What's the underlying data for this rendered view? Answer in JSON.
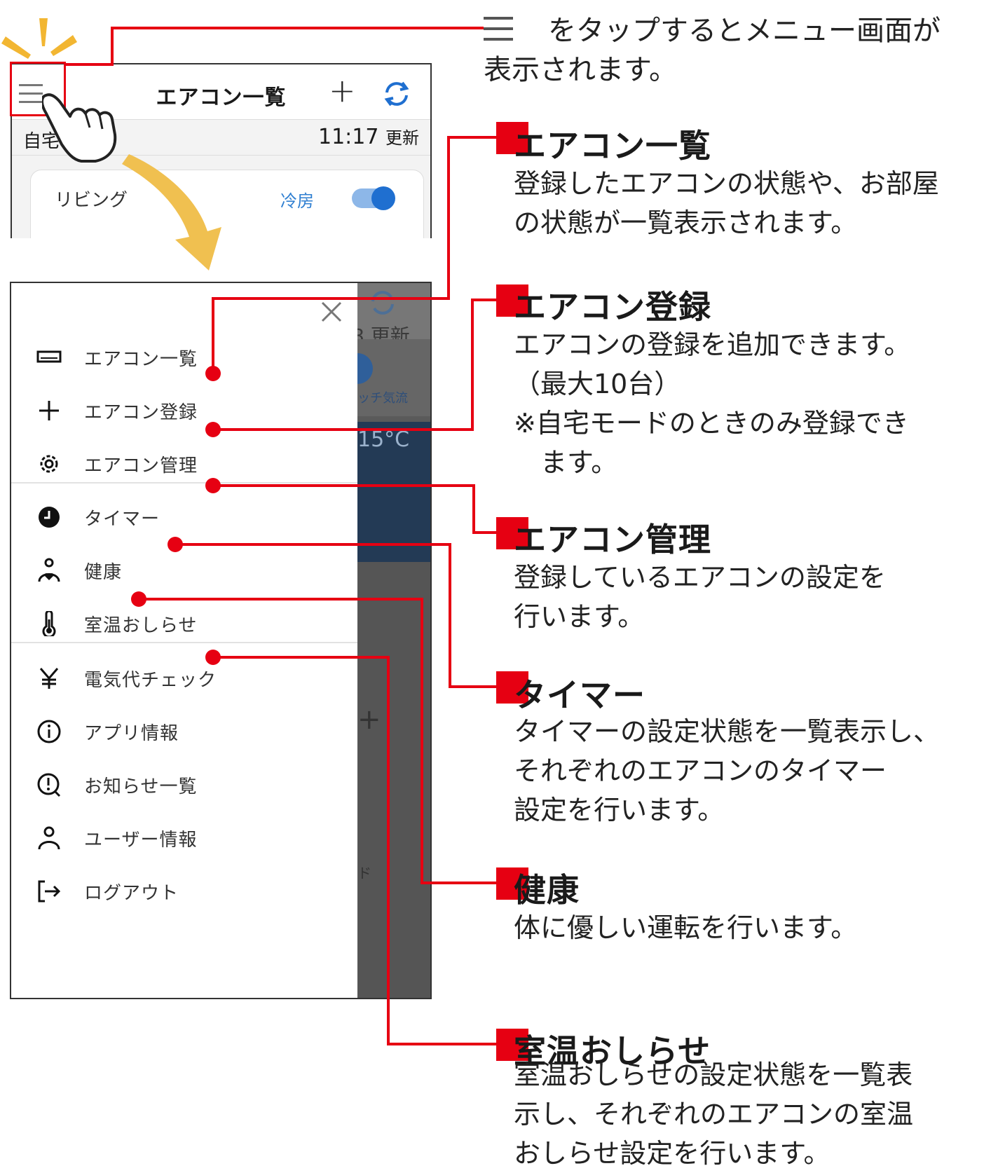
{
  "intro": {
    "line1": "をタップするとメニュー画面が",
    "line2": "表示されます。"
  },
  "top_screen": {
    "title": "エアコン一覧",
    "home": "自宅",
    "time": "11:17",
    "updated": "更新",
    "room": "リビング",
    "mode": "冷房"
  },
  "drawer": {
    "bg_update": "8 更新",
    "bg_touch": "ッチ気流",
    "bg_temp": "15°C",
    "bg_glyph": "ド",
    "items": [
      {
        "label": "エアコン一覧",
        "icon": "aircon-list-icon"
      },
      {
        "label": "エアコン登録",
        "icon": "plus-icon"
      },
      {
        "label": "エアコン管理",
        "icon": "gear-icon"
      },
      {
        "label": "タイマー",
        "icon": "clock-icon"
      },
      {
        "label": "健康",
        "icon": "health-icon"
      },
      {
        "label": "室温おしらせ",
        "icon": "thermometer-icon"
      },
      {
        "label": "電気代チェック",
        "icon": "yen-icon"
      },
      {
        "label": "アプリ情報",
        "icon": "info-icon"
      },
      {
        "label": "お知らせ一覧",
        "icon": "notice-icon"
      },
      {
        "label": "ユーザー情報",
        "icon": "user-icon"
      },
      {
        "label": "ログアウト",
        "icon": "logout-icon"
      }
    ]
  },
  "callouts": [
    {
      "title": "エアコン一覧",
      "lines": [
        "登録したエアコンの状態や、お部屋",
        "の状態が一覧表示されます。"
      ]
    },
    {
      "title": "エアコン登録",
      "lines": [
        "エアコンの登録を追加できます。",
        "（最大10台）",
        "※自宅モードのときのみ登録でき",
        "　ます。"
      ]
    },
    {
      "title": "エアコン管理",
      "lines": [
        "登録しているエアコンの設定を",
        "行います。"
      ]
    },
    {
      "title": "タイマー",
      "lines": [
        "タイマーの設定状態を一覧表示し、",
        "それぞれのエアコンのタイマー",
        "設定を行います。"
      ]
    },
    {
      "title": "健康",
      "lines": [
        "体に優しい運転を行います。"
      ]
    },
    {
      "title": "室温おしらせ",
      "lines": [
        "室温おしらせの設定状態を一覧表",
        "示し、それぞれのエアコンの室温",
        "おしらせ設定を行います。"
      ]
    }
  ],
  "colors": {
    "accent_red": "#e60012",
    "toggle_blue": "#1f6fd0"
  }
}
